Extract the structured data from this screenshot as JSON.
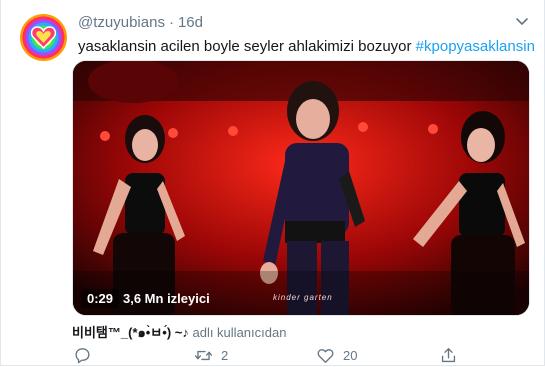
{
  "tweet": {
    "handle": "@tzuyubians",
    "separator": "·",
    "time": "16d",
    "text": "yasaklansin acilen boyle seyler ahlakimizi bozuyor ",
    "hashtag": "#kpopyasaklansin"
  },
  "media": {
    "duration": "0:29",
    "views": "3,6 Mn izleyici",
    "watermark": "kinder garten"
  },
  "attribution": {
    "source_name": "비비탬™_(*๑•̀ㅂ•́)",
    "source_suffix": " ~♪",
    "label": " adlı kullanıcıdan"
  },
  "actions": {
    "reply_count": "",
    "retweet_count": "2",
    "like_count": "20"
  },
  "icons": [
    "heart-avatar-icon",
    "chevron-down-icon",
    "reply-icon",
    "retweet-icon",
    "like-icon",
    "share-icon"
  ],
  "colors": {
    "link": "#1da1f2",
    "muted": "#657786",
    "text": "#14171a",
    "stage_red": "#d10f0f"
  }
}
